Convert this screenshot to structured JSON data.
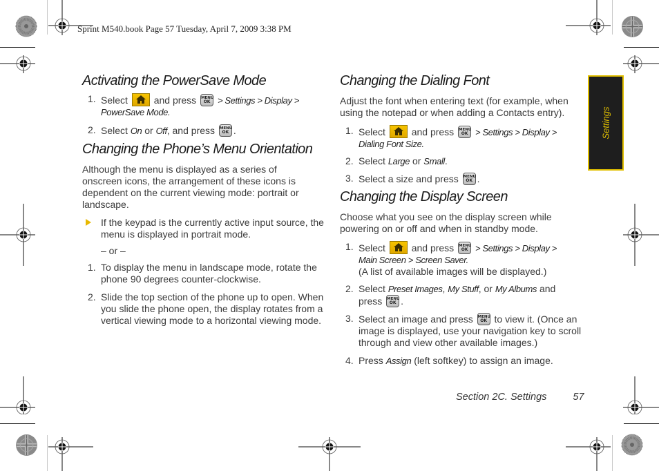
{
  "slug": "Sprint M540.book  Page 57  Tuesday, April 7, 2009  3:38 PM",
  "icons": {
    "home": "home-key-icon",
    "menu_ok": {
      "name": "menu-ok-key-icon",
      "top": "MENU",
      "bottom": "OK"
    },
    "bullet": "arrow-bullet-icon",
    "registration": "registration-mark-icon",
    "color_bar": "color-wheel-mark-icon"
  },
  "colors": {
    "accent": "#e2c000",
    "tab_bg": "#1e1e1e",
    "home_key": "#f2bb00"
  },
  "left": {
    "s1": {
      "title": "Activating the PowerSave Mode",
      "steps": [
        {
          "num": "1.",
          "pre": "Select",
          "mid": "and press",
          "path1": "> Settings > Display >",
          "path2": "PowerSave Mode."
        },
        {
          "num": "2.",
          "pre": "Select",
          "opt1": "On",
          "or": "or",
          "opt2": "Off",
          "post": ", and press",
          "end": "."
        }
      ]
    },
    "s2": {
      "title": "Changing the Phone’s Menu Orientation",
      "intro": "Although the menu is displayed as a series of onscreen icons, the arrangement of these icons is dependent on the current viewing mode: portrait or landscape.",
      "bullet": "If the keypad is the currently active input source, the menu is displayed in portrait mode.",
      "or": "– or –",
      "steps": [
        {
          "num": "1.",
          "text": "To display the menu in landscape mode, rotate the phone 90 degrees counter-clockwise."
        },
        {
          "num": "2.",
          "text": "Slide the top section of the phone up to open. When you slide the phone open, the display rotates from a vertical viewing mode to a horizontal viewing mode."
        }
      ]
    }
  },
  "right": {
    "s3": {
      "title": "Changing the Dialing Font",
      "intro": "Adjust the font when entering text (for example, when using the notepad or when adding a Contacts entry).",
      "steps": [
        {
          "num": "1.",
          "pre": "Select",
          "mid": "and press",
          "path1": "> Settings > Display >",
          "path2": "Dialing Font Size."
        },
        {
          "num": "2.",
          "pre": "Select",
          "opt1": "Large",
          "or": "or",
          "opt2": "Small",
          "end": "."
        },
        {
          "num": "3.",
          "pre": "Select a size and press",
          "end": "."
        }
      ]
    },
    "s4": {
      "title": "Changing the Display Screen",
      "intro": "Choose what you see on the display screen while powering on or off and when in standby mode.",
      "steps": [
        {
          "num": "1.",
          "pre": "Select",
          "mid": "and press",
          "path1": "> Settings > Display >",
          "path2": "Main Screen > Screen Saver.",
          "note": "(A list of available images will be displayed.)"
        },
        {
          "num": "2.",
          "pre": "Select",
          "opt1": "Preset Images",
          "sep": ",",
          "opt2": "My Stuff",
          "or": ", or",
          "opt3": "My Albums",
          "post": "and",
          "line2": "press",
          "end": "."
        },
        {
          "num": "3.",
          "pre": "Select an image and press",
          "post": "to view it. (Once an image is displayed, use your navigation key to scroll through and view other available images.)"
        },
        {
          "num": "4.",
          "pre": "Press",
          "opt1": "Assign",
          "post": "(left softkey) to assign an image."
        }
      ]
    }
  },
  "tab": {
    "label": "Settings"
  },
  "footer": {
    "section": "Section 2C. Settings",
    "page": "57"
  }
}
